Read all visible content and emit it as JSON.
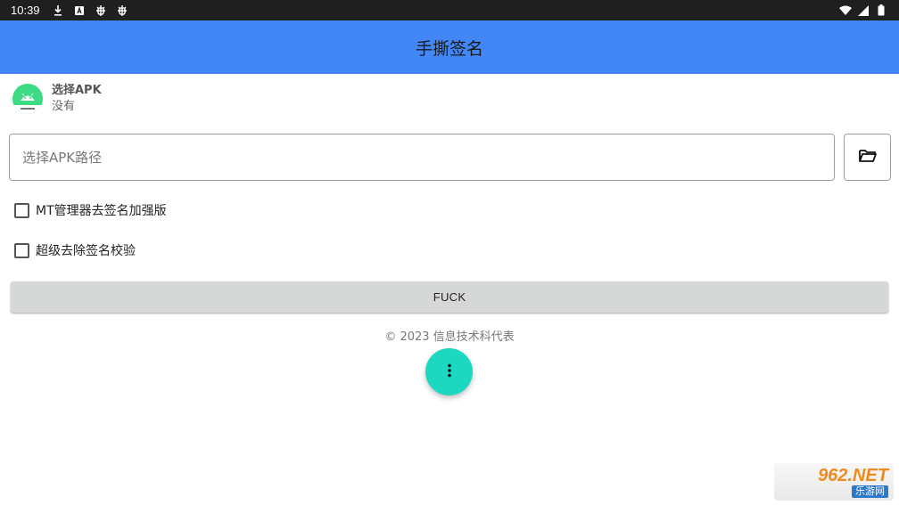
{
  "status_bar": {
    "time": "10:39"
  },
  "app_bar": {
    "title": "手撕签名"
  },
  "apk_info": {
    "name": "选择APK",
    "status": "没有"
  },
  "path_input": {
    "placeholder": "选择APK路径",
    "value": ""
  },
  "options": [
    {
      "label": "MT管理器去签名加强版",
      "checked": false
    },
    {
      "label": "超级去除签名校验",
      "checked": false
    }
  ],
  "action_button": {
    "label": "FUCK"
  },
  "footer": {
    "text": "© 2023 信息技术科代表"
  },
  "watermark": {
    "top": "962.NET",
    "bottom": "乐游网"
  },
  "colors": {
    "app_bar": "#4287f5",
    "fab": "#1dd8c0",
    "button": "#d6d7d7",
    "status_bar": "#1f1f1f"
  },
  "icons": {
    "folder_button": "folder-open-icon",
    "fab": "more-vertical-icon"
  }
}
